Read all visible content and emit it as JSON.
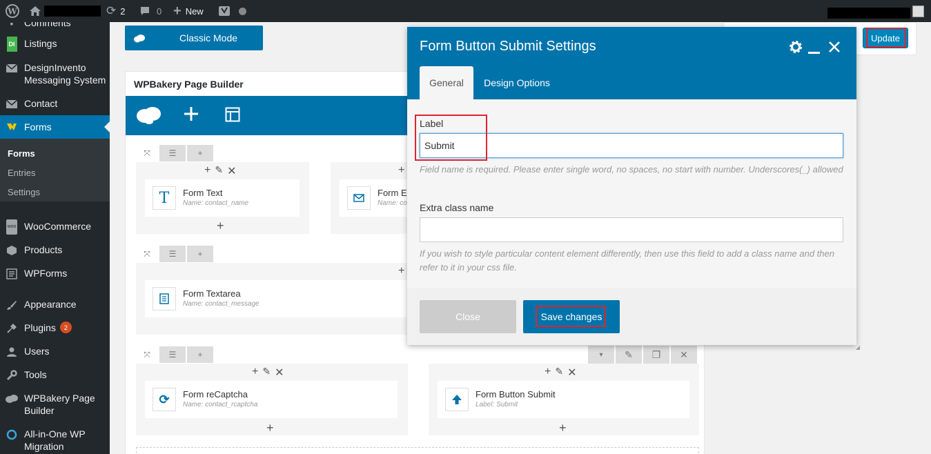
{
  "adminbar": {
    "updates_count": "2",
    "comments_count": "0",
    "new_label": "New"
  },
  "sidebar": {
    "items": [
      {
        "label": "Comments"
      },
      {
        "label": "Listings",
        "icon_text": "DI"
      },
      {
        "label": "DesignInvento Messaging System"
      },
      {
        "label": "Contact"
      },
      {
        "label": "Forms"
      },
      {
        "label": "WooCommerce",
        "icon_text": "woo"
      },
      {
        "label": "Products"
      },
      {
        "label": "WPForms"
      },
      {
        "label": "Appearance"
      },
      {
        "label": "Plugins",
        "badge": "2"
      },
      {
        "label": "Users"
      },
      {
        "label": "Tools"
      },
      {
        "label": "WPBakery Page Builder"
      },
      {
        "label": "All-in-One WP Migration"
      }
    ],
    "submenu": [
      "Forms",
      "Entries",
      "Settings"
    ]
  },
  "main": {
    "classic_mode_label": "Classic Mode",
    "builder_title": "WPBakery Page Builder",
    "update_label": "Update",
    "elements": [
      {
        "title": "Form Text",
        "sub": "Name: contact_name"
      },
      {
        "title": "Form Em",
        "sub": "Name: co"
      },
      {
        "title": "Form Textarea",
        "sub": "Name: contact_message"
      },
      {
        "title": "Form reCaptcha",
        "sub": "Name: contact_rcaptcha"
      },
      {
        "title": "Form Button Submit",
        "sub": "Label: Submit"
      }
    ]
  },
  "modal": {
    "title": "Form Button Submit Settings",
    "tabs": [
      "General",
      "Design Options"
    ],
    "label_field": {
      "label": "Label",
      "value": "Submit",
      "help": "Field name is required. Please enter single word, no spaces, no start with number. Underscores(_) allowed"
    },
    "class_field": {
      "label": "Extra class name",
      "value": "",
      "help": "If you wish to style particular content element differently, then use this field to add a class name and then refer to it in your css file."
    },
    "close_label": "Close",
    "save_label": "Save changes"
  },
  "colors": {
    "accent": "#0073aa",
    "adminbar": "#23282d",
    "highlight": "#e02330"
  }
}
